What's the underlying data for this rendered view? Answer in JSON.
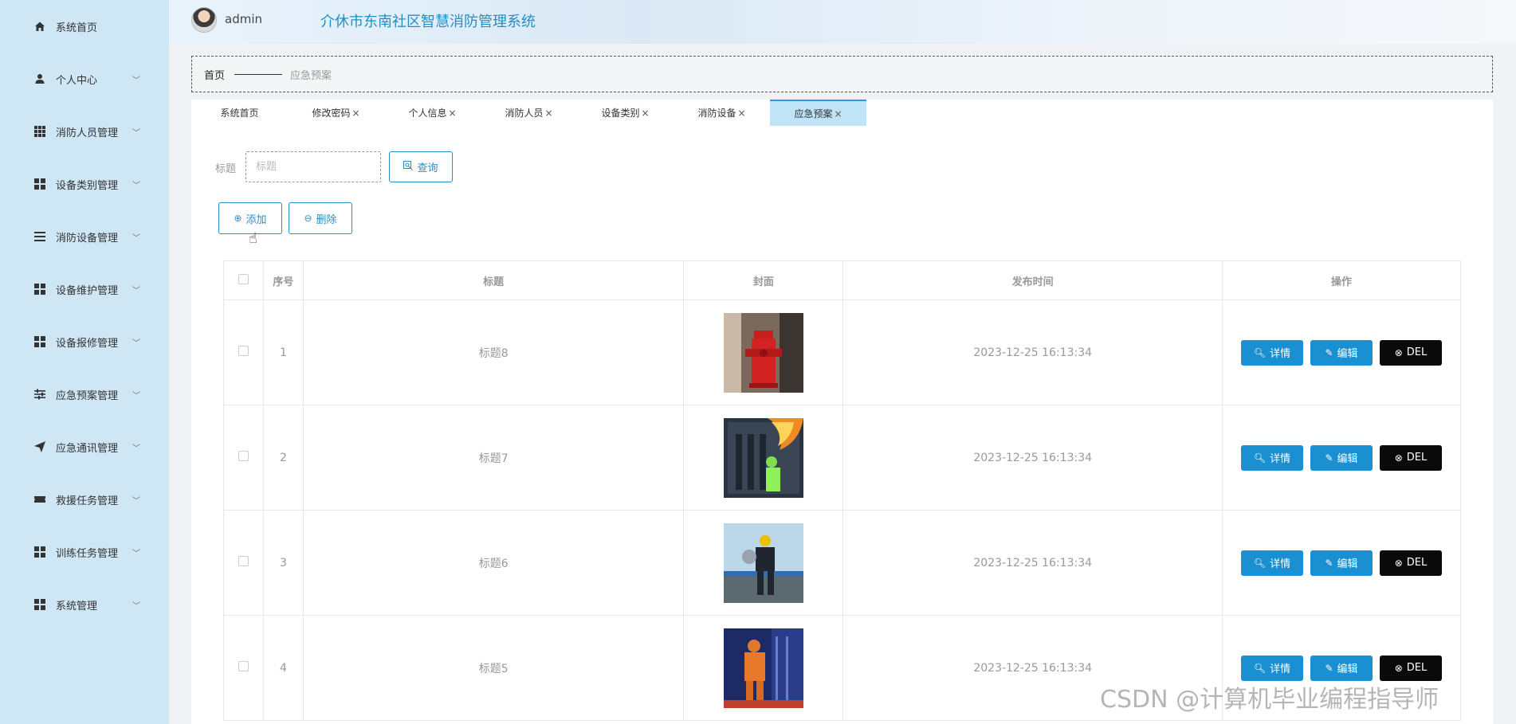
{
  "header": {
    "username": "admin",
    "system_title": "介休市东南社区智慧消防管理系统"
  },
  "sidebar": {
    "items": [
      {
        "label": "系统首页",
        "icon": "home-icon",
        "has_submenu": false
      },
      {
        "label": "个人中心",
        "icon": "user-icon",
        "has_submenu": true
      },
      {
        "label": "消防人员管理",
        "icon": "grid-icon",
        "has_submenu": true
      },
      {
        "label": "设备类别管理",
        "icon": "apps-icon",
        "has_submenu": true
      },
      {
        "label": "消防设备管理",
        "icon": "list-icon",
        "has_submenu": true
      },
      {
        "label": "设备维护管理",
        "icon": "apps-icon",
        "has_submenu": true
      },
      {
        "label": "设备报修管理",
        "icon": "apps-icon",
        "has_submenu": true
      },
      {
        "label": "应急预案管理",
        "icon": "sliders-icon",
        "has_submenu": true
      },
      {
        "label": "应急通讯管理",
        "icon": "send-icon",
        "has_submenu": true
      },
      {
        "label": "救援任务管理",
        "icon": "ticket-icon",
        "has_submenu": true
      },
      {
        "label": "训练任务管理",
        "icon": "apps-icon",
        "has_submenu": true
      },
      {
        "label": "系统管理",
        "icon": "apps-icon",
        "has_submenu": true
      }
    ]
  },
  "breadcrumb": {
    "home": "首页",
    "current": "应急预案"
  },
  "tabs": [
    {
      "label": "系统首页",
      "closable": false,
      "active": false
    },
    {
      "label": "修改密码",
      "closable": true,
      "active": false
    },
    {
      "label": "个人信息",
      "closable": true,
      "active": false
    },
    {
      "label": "消防人员",
      "closable": true,
      "active": false
    },
    {
      "label": "设备类别",
      "closable": true,
      "active": false
    },
    {
      "label": "消防设备",
      "closable": true,
      "active": false
    },
    {
      "label": "应急预案",
      "closable": true,
      "active": true
    }
  ],
  "search": {
    "label": "标题",
    "placeholder": "标题",
    "value": "",
    "query_button": "查询"
  },
  "actions": {
    "add_button": "添加",
    "delete_button": "删除"
  },
  "table": {
    "columns": [
      "序号",
      "标题",
      "封面",
      "发布时间",
      "操作"
    ],
    "rows": [
      {
        "index": "1",
        "title": "标题8",
        "cover": "fire-hydrant-photo",
        "published": "2023-12-25 16:13:34"
      },
      {
        "index": "2",
        "title": "标题7",
        "cover": "firefighter-blaze-photo",
        "published": "2023-12-25 16:13:34"
      },
      {
        "index": "3",
        "title": "标题6",
        "cover": "firefighter-training-photo",
        "published": "2023-12-25 16:13:34"
      },
      {
        "index": "4",
        "title": "标题5",
        "cover": "firefighter-suit-photo",
        "published": "2023-12-25 16:13:34"
      }
    ],
    "row_buttons": {
      "detail": "详情",
      "edit": "编辑",
      "delete": "DEL"
    }
  },
  "watermark": "CSDN @计算机毕业编程指导师",
  "colors": {
    "sidebar_bg": "#cfe6f5",
    "accent": "#1a8fd1",
    "title": "#1e8fc9",
    "danger_btn": "#0a0a0a",
    "active_tab": "#bfe3f7"
  }
}
